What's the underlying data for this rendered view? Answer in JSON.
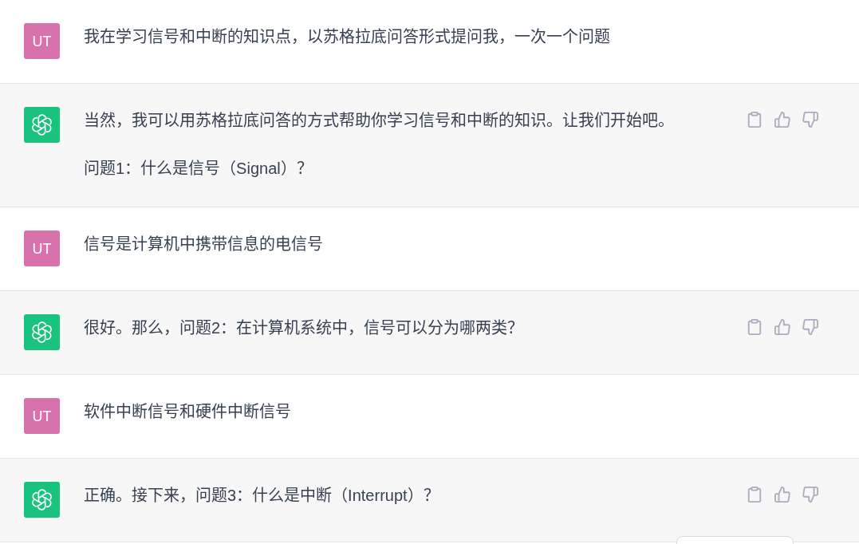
{
  "messages": [
    {
      "kind": "user",
      "avatar": "UT",
      "paragraphs": [
        "我在学习信号和中断的知识点，以苏格拉底问答形式提问我，一次一个问题"
      ]
    },
    {
      "kind": "assistant",
      "paragraphs": [
        "当然，我可以用苏格拉底问答的方式帮助你学习信号和中断的知识。让我们开始吧。",
        "问题1：什么是信号（Signal）？"
      ]
    },
    {
      "kind": "user",
      "avatar": "UT",
      "paragraphs": [
        "信号是计算机中携带信息的电信号"
      ]
    },
    {
      "kind": "assistant",
      "paragraphs": [
        "很好。那么，问题2：在计算机系统中，信号可以分为哪两类？"
      ]
    },
    {
      "kind": "user",
      "avatar": "UT",
      "paragraphs": [
        "软件中断信号和硬件中断信号"
      ]
    },
    {
      "kind": "assistant",
      "paragraphs": [
        "正确。接下来，问题3：什么是中断（Interrupt）？"
      ]
    }
  ]
}
